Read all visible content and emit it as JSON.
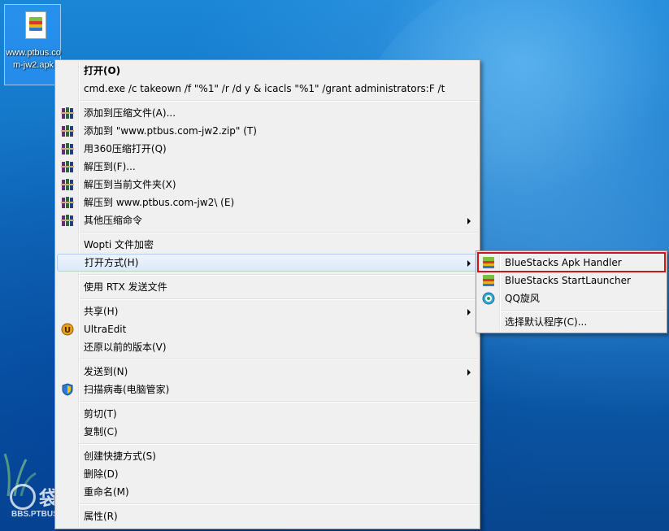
{
  "desktop": {
    "file_icon_label": "www.ptbus.com-jw2.apk",
    "watermark_cn": "袋巴士",
    "watermark_en": "BBS.PTBUS.COM"
  },
  "context_menu": {
    "open": "打开(O)",
    "cmd_takeown": "cmd.exe /c takeown /f \"%1\" /r /d y & icacls \"%1\" /grant administrators:F /t",
    "add_to_archive": "添加到压缩文件(A)...",
    "add_to_zip": "添加到 \"www.ptbus.com-jw2.zip\" (T)",
    "open_with_360": "用360压缩打开(Q)",
    "extract_to": "解压到(F)...",
    "extract_here": "解压到当前文件夹(X)",
    "extract_to_folder": "解压到 www.ptbus.com-jw2\\ (E)",
    "other_commands": "其他压缩命令",
    "wopti_encrypt": "Wopti 文件加密",
    "open_with": "打开方式(H)",
    "send_with_rtx": "使用 RTX 发送文件",
    "share": "共享(H)",
    "ultraedit": "UltraEdit",
    "restore_versions": "还原以前的版本(V)",
    "send_to": "发送到(N)",
    "scan_virus": "扫描病毒(电脑管家)",
    "cut": "剪切(T)",
    "copy": "复制(C)",
    "create_shortcut": "创建快捷方式(S)",
    "delete": "删除(D)",
    "rename": "重命名(M)",
    "properties": "属性(R)"
  },
  "open_with_submenu": {
    "bluestacks_apk_handler": "BlueStacks Apk Handler",
    "bluestacks_startlauncher": "BlueStacks StartLauncher",
    "qq_xuanfeng": "QQ旋风",
    "choose_default": "选择默认程序(C)..."
  },
  "colors": {
    "menu_bg": "#f0f0f0",
    "highlight_border": "#aecff7",
    "red_box": "#d0141d",
    "desktop_blue": "#1270c2"
  }
}
